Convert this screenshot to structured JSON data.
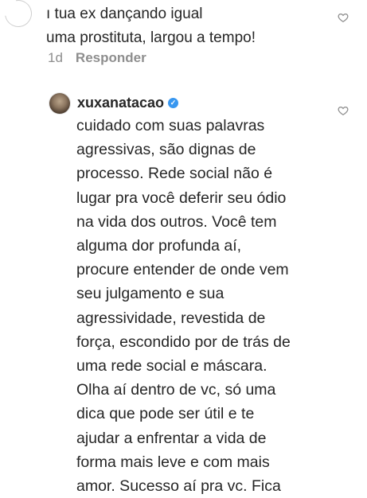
{
  "top_comment": {
    "text_line_1": "ı tua ex dançando igual",
    "text_line_2": "uma prostituta, largou a tempo!",
    "time": "1d",
    "reply_label": "Responder"
  },
  "reply_comment": {
    "username": "xuxanatacao",
    "verified_mark": "✓",
    "body": "cuidado com suas palavras\nagressivas, são dignas de\nprocesso. Rede social não é\nlugar pra você deferir seu ódio\nna vida dos outros. Você tem\nalguma dor profunda aí,\nprocure entender de onde vem\nseu julgamento e sua\nagressividade, revestida de\nforça, escondido por de trás de\numa rede social e máscara.\nOlha aí dentro de vc, só  uma\ndica que pode ser útil e te\najudar a enfrentar a vida de\nforma mais leve e com mais\namor. Sucesso aí pra vc. Fica"
  },
  "icons": {
    "like_top": "heart-outline-icon",
    "like_reply": "heart-outline-icon"
  }
}
